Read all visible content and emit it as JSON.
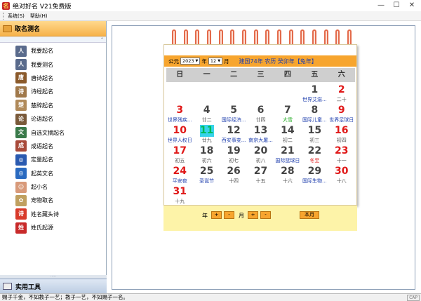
{
  "window": {
    "title": "绝对好名  V21免费版",
    "min": "—",
    "max": "☐",
    "close": "✕"
  },
  "menu": [
    "系统(S)",
    "帮助(H)"
  ],
  "sidebar": {
    "header": "取名测名",
    "scroll_arrow": "⌃",
    "items": [
      {
        "label": "我要起名",
        "icon": "person-search-icon",
        "color": "#5a6b8c",
        "glyph": "人"
      },
      {
        "label": "我要测名",
        "icon": "person-search-icon",
        "color": "#5a6b8c",
        "glyph": "人"
      },
      {
        "label": "唐诗起名",
        "icon": "tang-poem-icon",
        "color": "#8b5a2b",
        "glyph": "唐"
      },
      {
        "label": "诗经起名",
        "icon": "book-icon",
        "color": "#a0784a",
        "glyph": "诗"
      },
      {
        "label": "楚辞起名",
        "icon": "scroll-icon",
        "color": "#b08a5a",
        "glyph": "楚"
      },
      {
        "label": "论语起名",
        "icon": "confucius-icon",
        "color": "#7a5a3a",
        "glyph": "论"
      },
      {
        "label": "自选文摘起名",
        "icon": "textbook-icon",
        "color": "#3a7a4a",
        "glyph": "文"
      },
      {
        "label": "成语起名",
        "icon": "idiom-book-icon",
        "color": "#a84a3a",
        "glyph": "成"
      },
      {
        "label": "定量起名",
        "icon": "globe-icon",
        "color": "#2a5ab0",
        "glyph": "◎"
      },
      {
        "label": "起英文名",
        "icon": "globe-icon",
        "color": "#2a6ac0",
        "glyph": "◎"
      },
      {
        "label": "起小名",
        "icon": "baby-icon",
        "color": "#d89a7a",
        "glyph": "☺"
      },
      {
        "label": "宠物取名",
        "icon": "pet-icon",
        "color": "#c0a060",
        "glyph": "✿"
      },
      {
        "label": "姓名藏头诗",
        "icon": "poem-icon",
        "color": "#d83a2a",
        "glyph": "诗"
      },
      {
        "label": "姓氏起源",
        "icon": "surname-origin-icon",
        "color": "#c82a2a",
        "glyph": "姓"
      }
    ],
    "splitter": "·····",
    "footer": "实用工具"
  },
  "calendar": {
    "era_label": "公元",
    "year": "2023",
    "year_unit": "年",
    "month": "12",
    "month_unit": "月",
    "lunar_info": "建国74年 农历 癸卯年【兔年】",
    "weekdays": [
      "日",
      "一",
      "二",
      "三",
      "四",
      "五",
      "六"
    ],
    "days": [
      {
        "n": "",
        "s": ""
      },
      {
        "n": "",
        "s": ""
      },
      {
        "n": "",
        "s": ""
      },
      {
        "n": "",
        "s": ""
      },
      {
        "n": "",
        "s": ""
      },
      {
        "n": "1",
        "s": "世界艾滋...",
        "sc": "blue"
      },
      {
        "n": "2",
        "s": "二十",
        "red": true
      },
      {
        "n": "3",
        "s": "世界残疾...",
        "sc": "blue",
        "red": true
      },
      {
        "n": "4",
        "s": "廿二"
      },
      {
        "n": "5",
        "s": "国际经济...",
        "sc": "blue"
      },
      {
        "n": "6",
        "s": "廿四"
      },
      {
        "n": "7",
        "s": "大雪",
        "sc": "green"
      },
      {
        "n": "8",
        "s": "国际儿童...",
        "sc": "blue"
      },
      {
        "n": "9",
        "s": "世界足球日",
        "sc": "blue",
        "red": true
      },
      {
        "n": "10",
        "s": "世界人权日",
        "sc": "blue",
        "red": true
      },
      {
        "n": "11",
        "s": "廿九",
        "today": true
      },
      {
        "n": "12",
        "s": "西安事变...",
        "sc": "blue"
      },
      {
        "n": "13",
        "s": "南京大屠...",
        "sc": "blue"
      },
      {
        "n": "14",
        "s": "初二"
      },
      {
        "n": "15",
        "s": "初三"
      },
      {
        "n": "16",
        "s": "初四",
        "red": true
      },
      {
        "n": "17",
        "s": "初五",
        "red": true
      },
      {
        "n": "18",
        "s": "初六"
      },
      {
        "n": "19",
        "s": "初七"
      },
      {
        "n": "20",
        "s": "初八"
      },
      {
        "n": "21",
        "s": "国际篮球日",
        "sc": "blue"
      },
      {
        "n": "22",
        "s": "冬至",
        "sc": "red"
      },
      {
        "n": "23",
        "s": "十一",
        "red": true
      },
      {
        "n": "24",
        "s": "平安夜",
        "sc": "blue",
        "red": true
      },
      {
        "n": "25",
        "s": "圣诞节",
        "sc": "blue"
      },
      {
        "n": "26",
        "s": "十四"
      },
      {
        "n": "27",
        "s": "十五"
      },
      {
        "n": "28",
        "s": "十六"
      },
      {
        "n": "29",
        "s": "国际生物...",
        "sc": "blue"
      },
      {
        "n": "30",
        "s": "十八",
        "red": true
      },
      {
        "n": "31",
        "s": "十九",
        "red": true
      }
    ],
    "controls": {
      "year_label": "年",
      "month_label": "月",
      "plus": "+",
      "minus": "-",
      "this_month": "本月"
    }
  },
  "status": {
    "text": "赐子千金，不如教子一艺；教子一艺，不如赐子一名。",
    "cap": "CAP"
  }
}
